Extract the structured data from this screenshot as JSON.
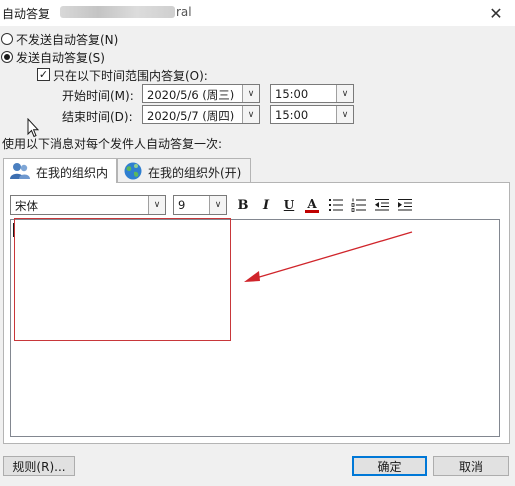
{
  "window": {
    "title": "自动答复",
    "title_tail": "ral",
    "close_glyph": "✕"
  },
  "options": {
    "no_reply_label": "不发送自动答复(N)",
    "send_reply_label": "发送自动答复(S)",
    "send_reply_selected": true,
    "time_range_label": "只在以下时间范围内答复(O):",
    "time_range_checked": true,
    "check_glyph": "✓"
  },
  "schedule": {
    "start_label": "开始时间(M):",
    "start_date": "2020/5/6 (周三)",
    "start_time": "15:00",
    "end_label": "结束时间(D):",
    "end_date": "2020/5/7 (周四)",
    "end_time": "15:00",
    "dropdown_glyph": "∨"
  },
  "instruction": "使用以下消息对每个发件人自动答复一次:",
  "tabs": [
    {
      "label": "在我的组织内",
      "active": true
    },
    {
      "label": "在我的组织外(开)",
      "active": false
    }
  ],
  "toolbar": {
    "font_name": "宋体",
    "font_size": "9",
    "bold": "B",
    "italic": "I",
    "underline": "U",
    "font_color_letter": "A",
    "font_color": "#c00000"
  },
  "colors": {
    "highlight_border": "#c8373a",
    "arrow": "#d0252b",
    "default_button_border": "#0078d7"
  },
  "buttons": {
    "rules": "规则(R)...",
    "ok": "确定",
    "cancel": "取消"
  }
}
